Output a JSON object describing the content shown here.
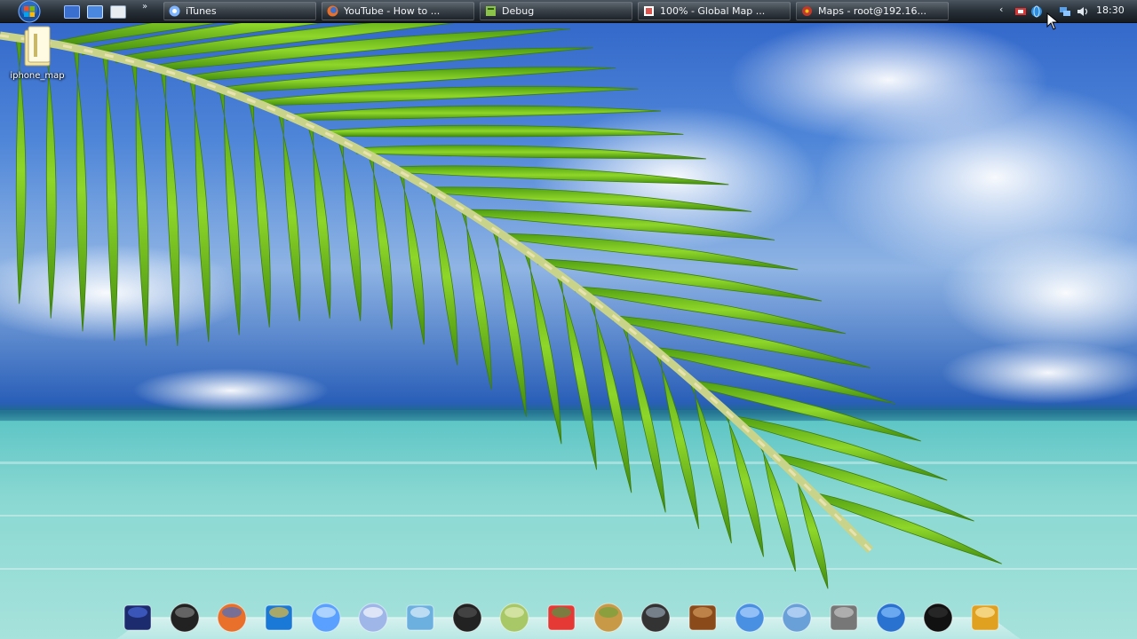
{
  "taskbar": {
    "start_button": "start-orb",
    "quick_launch": [
      {
        "name": "show-desktop-icon",
        "color": "#3a6fd0"
      },
      {
        "name": "switch-windows-icon",
        "color": "#4a88e0"
      },
      {
        "name": "notepad-icon",
        "color": "#e8edf2"
      }
    ],
    "quick_launch_more": "»",
    "tasks": [
      {
        "label": "iTunes",
        "icon": "itunes-icon",
        "icon_color": "#7fb4ff"
      },
      {
        "label": "YouTube - How to ...",
        "icon": "firefox-icon",
        "icon_color": "#e8702a"
      },
      {
        "label": "Debug",
        "icon": "debug-icon",
        "icon_color": "#8bc34a"
      },
      {
        "label": "100% - Global Map ...",
        "icon": "map-icon",
        "icon_color": "#d9534f"
      },
      {
        "label": "Maps - root@192.16...",
        "icon": "terminal-icon",
        "icon_color": "#c0392b"
      }
    ],
    "tray": {
      "chevron": "‹",
      "icons": [
        "network-alert-icon",
        "globe-icon",
        "network-icon",
        "volume-icon"
      ],
      "clock": "18:30"
    }
  },
  "desktop": {
    "icons": [
      {
        "label": "iphone_map",
        "icon": "folder-icon"
      }
    ]
  },
  "dock": {
    "items": [
      "computer-icon",
      "printer-icon",
      "firefox-icon",
      "internet-explorer-icon",
      "itunes-icon",
      "rocket-icon",
      "notepad-icon",
      "camcorder-icon",
      "map-paper-icon",
      "picasa-icon",
      "globe-icon",
      "laptop-icon",
      "photo-album-icon",
      "folder-icon",
      "folder-documents-icon",
      "tools-icon",
      "network-globe-icon",
      "tshirt-icon",
      "wrench-tools-icon"
    ]
  },
  "colors": {
    "taskbar_top": "#4a5560",
    "taskbar_bottom": "#151a20",
    "sky": "#2f63c8",
    "sea": "#8ad8d2",
    "palm_green": "#6cc51e"
  }
}
